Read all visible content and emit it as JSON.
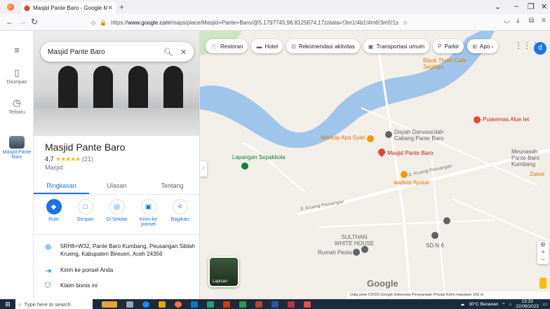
{
  "browser": {
    "tab_title": "Masjid Pante Baro - Google Maps",
    "url_host": "www.google.com",
    "url_prefix": "https://",
    "url_path": "/maps/place/Masjid+Pante+Baro/@5.1797745,96.8125674,17z/data=!3m1!4b1!4m6!3m5!1s"
  },
  "rail": {
    "saved_label": "Disimpan",
    "recent_label": "Terbaru",
    "place_label": "Masjid Pante Baro"
  },
  "search": {
    "value": "Masjid Pante Baro"
  },
  "place": {
    "title": "Masjid Pante Baro",
    "rating": "4,7",
    "stars": "★★★★★",
    "review_count": "(21)",
    "category": "Masjid"
  },
  "tabs": [
    "Ringkasan",
    "Ulasan",
    "Tentang"
  ],
  "actions": [
    {
      "label": "Rute",
      "icon": "◆"
    },
    {
      "label": "Simpan",
      "icon": "□"
    },
    {
      "label": "Di Sekitar",
      "icon": "◎"
    },
    {
      "label": "Kirim ke ponsel",
      "icon": "▣"
    },
    {
      "label": "Bagikan",
      "icon": "<"
    }
  ],
  "info": {
    "address": "5RH8+W32, Pante Baro Kumbang, Peusangan Siblah Krueng, Kabupaten Bireuen, Aceh 24356",
    "send_to_phone": "Kirim ke ponsel Anda",
    "claim": "Klaim bisnis ini"
  },
  "chips": [
    {
      "icon": "🍴",
      "label": "Restoran"
    },
    {
      "icon": "▬",
      "label": "Hotel"
    },
    {
      "icon": "⊡",
      "label": "Rekomendasi aktivitas"
    },
    {
      "icon": "▣",
      "label": "Transportasi umum"
    },
    {
      "icon": "P",
      "label": "Parkir"
    },
    {
      "icon": "⊞",
      "label": "Apo ›"
    }
  ],
  "avatar_letter": "d",
  "map_labels": {
    "black_thorn": "Black Thorn Cafe Segitiga",
    "puskemas": "Puskemas Alue Iet",
    "dayah": "Dayah Darussa'dah Cabang Pante Baro",
    "warkop_syari": "Warkop Apa Syari",
    "masjid": "Masjid Pante Baro",
    "meunasah": "Meunasah Pante Baro Kumbang",
    "lapangan": "Lapangan Sepakbola",
    "jl_krueng1": "Jl. Krueng Peusangan",
    "warkop_apatat": "warkop Apatat",
    "jl_krueng2": "Jl. Krueng Peusangan",
    "sulthan": "SULTHAN WHITE HOUSE",
    "rumah_pesta": "Rumah Pesta",
    "sdn": "SD N 6",
    "zakwi": "Zakwi",
    "google": "Google",
    "layers": "Lapisan",
    "attribution": "Data peta ©2023 Google   Indonesia   Persyaratan   Privasi   Kirim masukan   100 m"
  },
  "taskbar": {
    "search_placeholder": "Type here to search",
    "weather": "30°C Berawan",
    "time": "13:33",
    "date": "22/08/2023"
  }
}
